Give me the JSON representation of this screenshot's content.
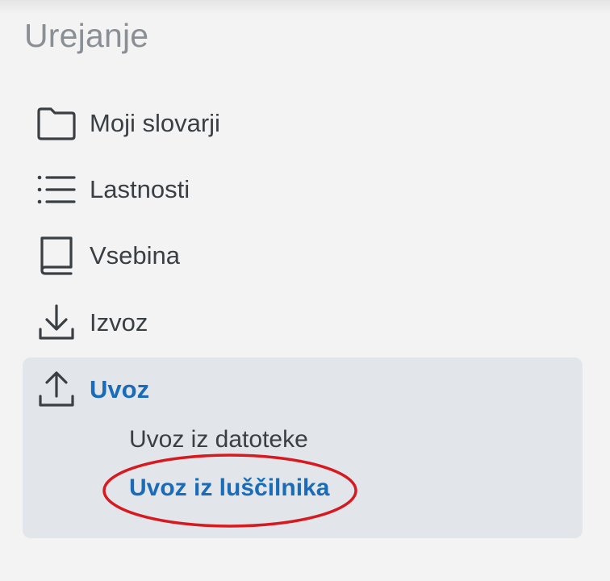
{
  "sidebar": {
    "heading": "Urejanje",
    "items": [
      {
        "label": "Moji slovarji",
        "icon": "folder-icon"
      },
      {
        "label": "Lastnosti",
        "icon": "list-icon"
      },
      {
        "label": "Vsebina",
        "icon": "book-icon"
      },
      {
        "label": "Izvoz",
        "icon": "download-icon"
      }
    ],
    "active_item": {
      "label": "Uvoz",
      "icon": "upload-icon",
      "subitems": [
        {
          "label": "Uvoz iz datoteke",
          "selected": false
        },
        {
          "label": "Uvoz iz luščilnika",
          "selected": true
        }
      ]
    }
  },
  "colors": {
    "background": "#f3f3f3",
    "heading": "#8a8f95",
    "text": "#3a3f44",
    "accent": "#1a6cb8",
    "active_background": "#e2e6ea",
    "annotation_ellipse": "#d71920"
  }
}
